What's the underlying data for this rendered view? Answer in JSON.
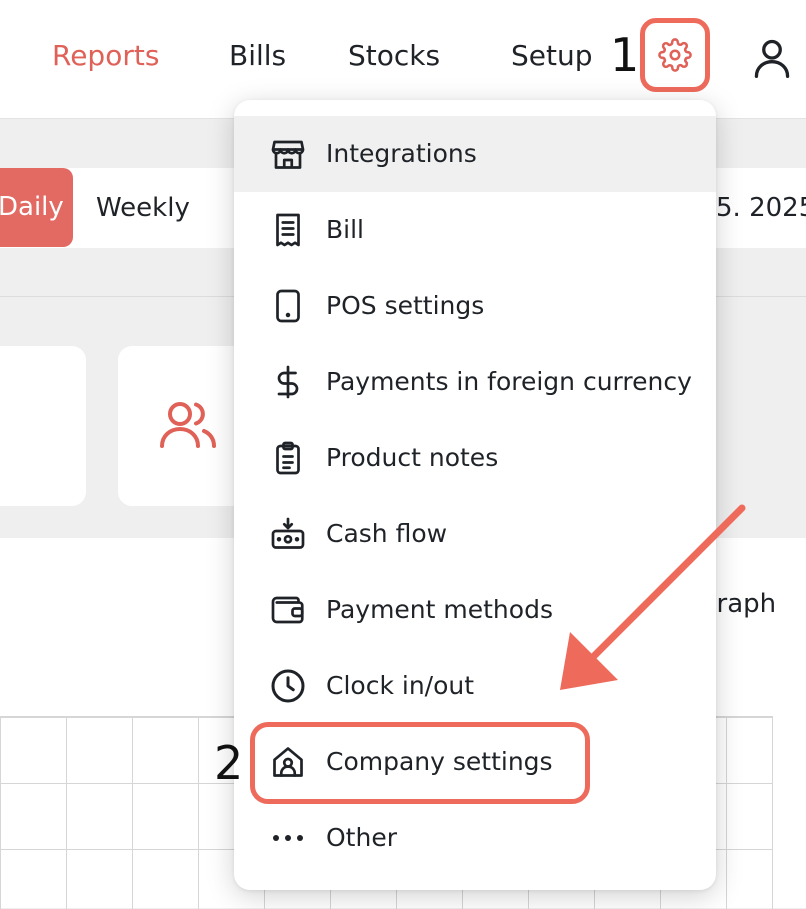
{
  "nav": {
    "items": [
      {
        "label": "Reports",
        "active": true
      },
      {
        "label": "Bills"
      },
      {
        "label": "Stocks"
      },
      {
        "label": "Setup"
      }
    ],
    "settings_icon": "gear-icon",
    "user_icon": "user-icon"
  },
  "annotations": {
    "step1": "1",
    "step2": "2"
  },
  "filters": {
    "daily": "Daily",
    "weekly": "Weekly",
    "date": "5. 2025"
  },
  "dashboard": {
    "graph_label": "graph"
  },
  "settings_menu": {
    "items": [
      {
        "label": "Integrations",
        "icon": "store-icon"
      },
      {
        "label": "Bill",
        "icon": "receipt-icon"
      },
      {
        "label": "POS settings",
        "icon": "tablet-icon"
      },
      {
        "label": "Payments in foreign currency",
        "icon": "dollar-icon"
      },
      {
        "label": "Product notes",
        "icon": "clipboard-icon"
      },
      {
        "label": "Cash flow",
        "icon": "cash-register-icon"
      },
      {
        "label": "Payment methods",
        "icon": "wallet-icon"
      },
      {
        "label": "Clock in/out",
        "icon": "clock-icon"
      },
      {
        "label": "Company settings",
        "icon": "house-icon"
      },
      {
        "label": "Other",
        "icon": "more-horizontal-icon"
      }
    ]
  },
  "colors": {
    "accent": "#e06158",
    "annotation": "#ee6b5c",
    "active_button": "#e26a62"
  }
}
